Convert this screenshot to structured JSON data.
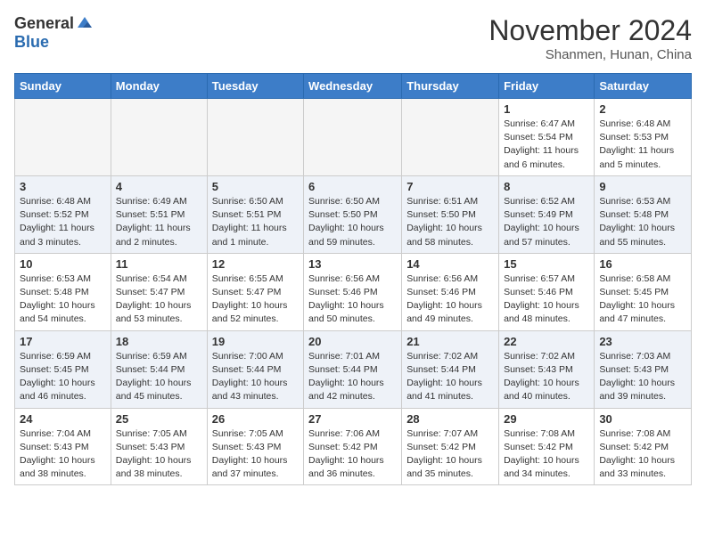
{
  "header": {
    "logo_general": "General",
    "logo_blue": "Blue",
    "month": "November 2024",
    "location": "Shanmen, Hunan, China"
  },
  "weekdays": [
    "Sunday",
    "Monday",
    "Tuesday",
    "Wednesday",
    "Thursday",
    "Friday",
    "Saturday"
  ],
  "weeks": [
    [
      {
        "day": "",
        "info": ""
      },
      {
        "day": "",
        "info": ""
      },
      {
        "day": "",
        "info": ""
      },
      {
        "day": "",
        "info": ""
      },
      {
        "day": "",
        "info": ""
      },
      {
        "day": "1",
        "info": "Sunrise: 6:47 AM\nSunset: 5:54 PM\nDaylight: 11 hours\nand 6 minutes."
      },
      {
        "day": "2",
        "info": "Sunrise: 6:48 AM\nSunset: 5:53 PM\nDaylight: 11 hours\nand 5 minutes."
      }
    ],
    [
      {
        "day": "3",
        "info": "Sunrise: 6:48 AM\nSunset: 5:52 PM\nDaylight: 11 hours\nand 3 minutes."
      },
      {
        "day": "4",
        "info": "Sunrise: 6:49 AM\nSunset: 5:51 PM\nDaylight: 11 hours\nand 2 minutes."
      },
      {
        "day": "5",
        "info": "Sunrise: 6:50 AM\nSunset: 5:51 PM\nDaylight: 11 hours\nand 1 minute."
      },
      {
        "day": "6",
        "info": "Sunrise: 6:50 AM\nSunset: 5:50 PM\nDaylight: 10 hours\nand 59 minutes."
      },
      {
        "day": "7",
        "info": "Sunrise: 6:51 AM\nSunset: 5:50 PM\nDaylight: 10 hours\nand 58 minutes."
      },
      {
        "day": "8",
        "info": "Sunrise: 6:52 AM\nSunset: 5:49 PM\nDaylight: 10 hours\nand 57 minutes."
      },
      {
        "day": "9",
        "info": "Sunrise: 6:53 AM\nSunset: 5:48 PM\nDaylight: 10 hours\nand 55 minutes."
      }
    ],
    [
      {
        "day": "10",
        "info": "Sunrise: 6:53 AM\nSunset: 5:48 PM\nDaylight: 10 hours\nand 54 minutes."
      },
      {
        "day": "11",
        "info": "Sunrise: 6:54 AM\nSunset: 5:47 PM\nDaylight: 10 hours\nand 53 minutes."
      },
      {
        "day": "12",
        "info": "Sunrise: 6:55 AM\nSunset: 5:47 PM\nDaylight: 10 hours\nand 52 minutes."
      },
      {
        "day": "13",
        "info": "Sunrise: 6:56 AM\nSunset: 5:46 PM\nDaylight: 10 hours\nand 50 minutes."
      },
      {
        "day": "14",
        "info": "Sunrise: 6:56 AM\nSunset: 5:46 PM\nDaylight: 10 hours\nand 49 minutes."
      },
      {
        "day": "15",
        "info": "Sunrise: 6:57 AM\nSunset: 5:46 PM\nDaylight: 10 hours\nand 48 minutes."
      },
      {
        "day": "16",
        "info": "Sunrise: 6:58 AM\nSunset: 5:45 PM\nDaylight: 10 hours\nand 47 minutes."
      }
    ],
    [
      {
        "day": "17",
        "info": "Sunrise: 6:59 AM\nSunset: 5:45 PM\nDaylight: 10 hours\nand 46 minutes."
      },
      {
        "day": "18",
        "info": "Sunrise: 6:59 AM\nSunset: 5:44 PM\nDaylight: 10 hours\nand 45 minutes."
      },
      {
        "day": "19",
        "info": "Sunrise: 7:00 AM\nSunset: 5:44 PM\nDaylight: 10 hours\nand 43 minutes."
      },
      {
        "day": "20",
        "info": "Sunrise: 7:01 AM\nSunset: 5:44 PM\nDaylight: 10 hours\nand 42 minutes."
      },
      {
        "day": "21",
        "info": "Sunrise: 7:02 AM\nSunset: 5:44 PM\nDaylight: 10 hours\nand 41 minutes."
      },
      {
        "day": "22",
        "info": "Sunrise: 7:02 AM\nSunset: 5:43 PM\nDaylight: 10 hours\nand 40 minutes."
      },
      {
        "day": "23",
        "info": "Sunrise: 7:03 AM\nSunset: 5:43 PM\nDaylight: 10 hours\nand 39 minutes."
      }
    ],
    [
      {
        "day": "24",
        "info": "Sunrise: 7:04 AM\nSunset: 5:43 PM\nDaylight: 10 hours\nand 38 minutes."
      },
      {
        "day": "25",
        "info": "Sunrise: 7:05 AM\nSunset: 5:43 PM\nDaylight: 10 hours\nand 38 minutes."
      },
      {
        "day": "26",
        "info": "Sunrise: 7:05 AM\nSunset: 5:43 PM\nDaylight: 10 hours\nand 37 minutes."
      },
      {
        "day": "27",
        "info": "Sunrise: 7:06 AM\nSunset: 5:42 PM\nDaylight: 10 hours\nand 36 minutes."
      },
      {
        "day": "28",
        "info": "Sunrise: 7:07 AM\nSunset: 5:42 PM\nDaylight: 10 hours\nand 35 minutes."
      },
      {
        "day": "29",
        "info": "Sunrise: 7:08 AM\nSunset: 5:42 PM\nDaylight: 10 hours\nand 34 minutes."
      },
      {
        "day": "30",
        "info": "Sunrise: 7:08 AM\nSunset: 5:42 PM\nDaylight: 10 hours\nand 33 minutes."
      }
    ]
  ]
}
